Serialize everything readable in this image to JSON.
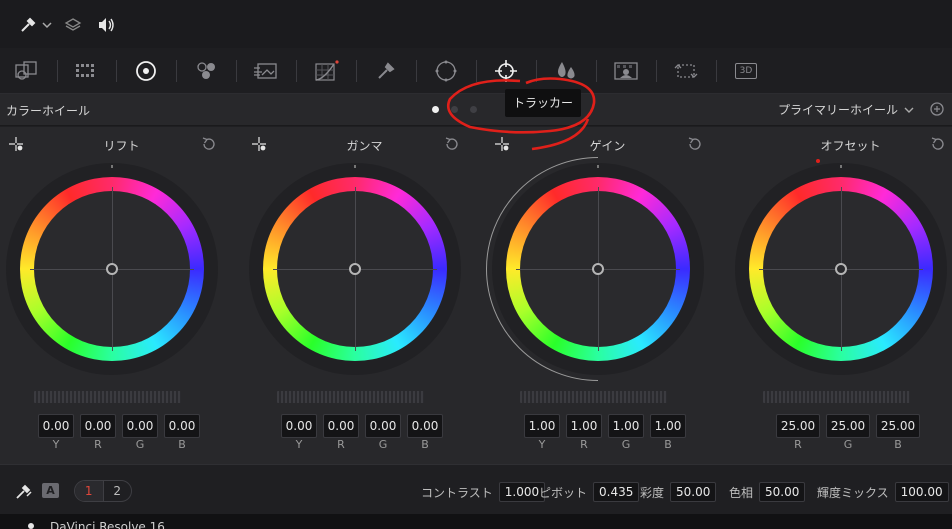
{
  "topbar": {
    "icons": [
      "eyedropper-icon",
      "chevron-down-icon",
      "layers-icon",
      "speaker-icon"
    ]
  },
  "toolbar": {
    "icons": [
      "camera-raw-icon",
      "color-match-icon",
      "color-wheels-icon",
      "rgb-mixer-icon",
      "motion-effects-icon",
      "curves-icon",
      "qualifier-icon",
      "window-icon",
      "tracker-icon",
      "magic-mask-icon",
      "blur-icon",
      "key-icon",
      "sizing-icon",
      "3d-icon"
    ],
    "three_d_label": "3D"
  },
  "header": {
    "title": "カラーホイール",
    "tooltip": "トラッカー",
    "mode": "プライマリーホイール"
  },
  "wheels": [
    {
      "name": "リフト",
      "values": [
        "0.00",
        "0.00",
        "0.00",
        "0.00"
      ],
      "channels": [
        "Y",
        "R",
        "G",
        "B"
      ]
    },
    {
      "name": "ガンマ",
      "values": [
        "0.00",
        "0.00",
        "0.00",
        "0.00"
      ],
      "channels": [
        "Y",
        "R",
        "G",
        "B"
      ]
    },
    {
      "name": "ゲイン",
      "values": [
        "1.00",
        "1.00",
        "1.00",
        "1.00"
      ],
      "channels": [
        "Y",
        "R",
        "G",
        "B"
      ]
    },
    {
      "name": "オフセット",
      "values": [
        "25.00",
        "25.00",
        "25.00"
      ],
      "channels": [
        "R",
        "G",
        "B"
      ]
    }
  ],
  "bottom": {
    "a_badge": "A",
    "page1": "1",
    "page2": "2",
    "contrast_label": "コントラスト",
    "contrast_value": "1.000",
    "pivot_label": "ピボット",
    "pivot_value": "0.435",
    "saturation_label": "彩度",
    "saturation_value": "50.00",
    "hue_label": "色相",
    "hue_value": "50.00",
    "lum_mix_label": "輝度ミックス",
    "lum_mix_value": "100.00"
  },
  "status": {
    "app_name": "DaVinci Resolve 16"
  },
  "colors": {
    "accent_red": "#e0463a",
    "annotation_red": "#e0201a",
    "panel_bg": "#28282b"
  }
}
